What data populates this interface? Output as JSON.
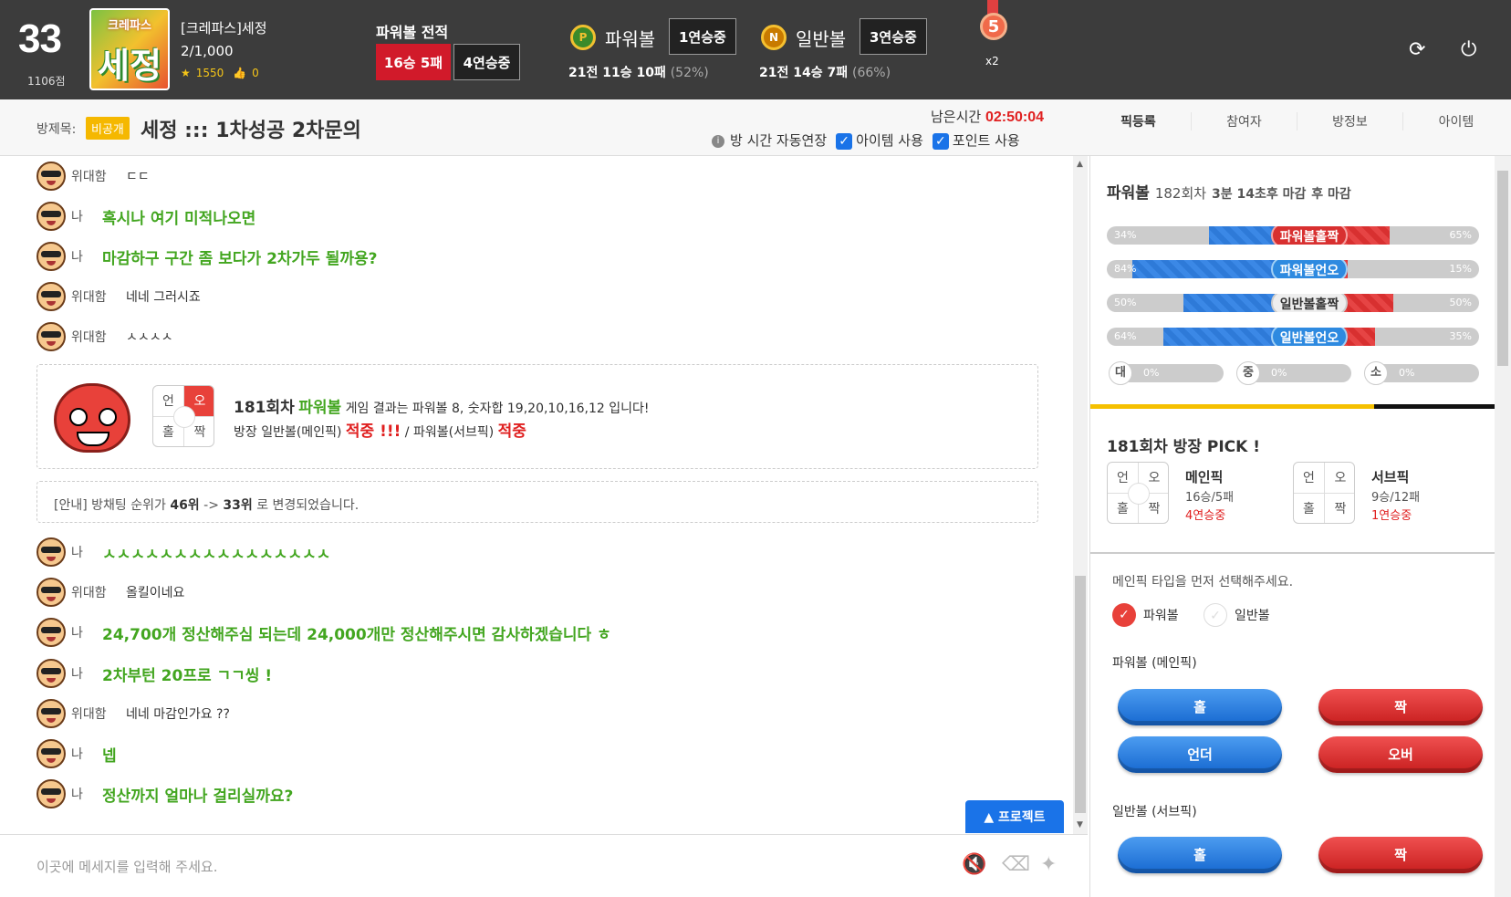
{
  "header": {
    "rank": "33",
    "rank_points": "1106점",
    "avatar_top": "크레파스",
    "avatar_main": "세정",
    "user_name": "[크레파스]세정",
    "user_count": "2/1,000",
    "stars": "1550",
    "likes": "0",
    "record_title": "파워볼 전적",
    "record_wl": "16승 5패",
    "record_streak": "4연승중",
    "powerball": {
      "coin": "P",
      "name": "파워볼",
      "streak": "1연승중",
      "record": "21전 11승 10패",
      "pct": "(52%)"
    },
    "normalball": {
      "coin": "N",
      "name": "일반볼",
      "streak": "3연승중",
      "record": "21전 14승 7패",
      "pct": "(66%)"
    },
    "medal_number": "5",
    "multiplier": "x2"
  },
  "room": {
    "label": "방제목:",
    "private": "비공개",
    "title": "세정 ::: 1차성공 2차문의",
    "remaining_label": "남은시간",
    "remaining_time": "02:50:04",
    "auto_extend": "방 시간 자동연장",
    "item_use": "아이템 사용",
    "point_use": "포인트 사용",
    "tabs": [
      "픽등록",
      "참여자",
      "방정보",
      "아이템"
    ]
  },
  "chat": {
    "messages": [
      {
        "who": "위대함",
        "text": "ㄷㄷ",
        "me": false
      },
      {
        "who": "나",
        "text": "혹시나 여기 미적나오면",
        "me": true
      },
      {
        "who": "나",
        "text": "마감하구 구간 좀 보다가 2차가두 될까용?",
        "me": true
      },
      {
        "who": "위대함",
        "text": "네네 그러시죠",
        "me": false
      },
      {
        "who": "위대함",
        "text": "ㅅㅅㅅㅅ",
        "me": false
      }
    ],
    "messages2": [
      {
        "who": "나",
        "text": "ㅅㅅㅅㅅㅅㅅㅅㅅㅅㅅㅅㅅㅅㅅㅅㅅ",
        "me": true
      },
      {
        "who": "위대함",
        "text": "올킬이네요",
        "me": false
      },
      {
        "who": "나",
        "text": "24,700개 정산해주심 되는데 24,000개만 정산해주시면 감사하겠습니다 ㅎ",
        "me": true
      },
      {
        "who": "나",
        "text": "2차부턴 20프로 ㄱㄱ씽 !",
        "me": true
      },
      {
        "who": "위대함",
        "text": "네네 마감인가요 ??",
        "me": false
      },
      {
        "who": "나",
        "text": "넵",
        "me": true
      },
      {
        "who": "나",
        "text": "정산까지 얼마나 걸리실까요?",
        "me": true
      }
    ],
    "result": {
      "grid": [
        "언",
        "오",
        "홀",
        "짝"
      ],
      "round": "181회차",
      "game": "파워볼",
      "line1": "게임 결과는 파워볼 8, 숫자합 19,20,10,16,12 입니다!",
      "line2a": "방장 일반볼(메인픽)",
      "hit1": "적중 !!!",
      "line2b": " / 파워볼(서브픽)",
      "hit2": "적중"
    },
    "notice_a": "[안내] 방채팅 순위가 ",
    "notice_from": "46위",
    "notice_b": " -> ",
    "notice_to": "33위",
    "notice_c": " 로 변경되었습니다.",
    "project_button": "▲ 프로젝트",
    "input_placeholder": "이곳에 메세지를 입력해 주세요."
  },
  "panel": {
    "game": "파워볼",
    "round": "182회차",
    "closing": "3분 14초후 마감",
    "closing_suffix": "후 마감",
    "bars": [
      {
        "label": "파워볼홀짝",
        "left": "34%",
        "right": "65%",
        "style": "red"
      },
      {
        "label": "파워볼언오",
        "left": "84%",
        "right": "15%",
        "style": "blue"
      },
      {
        "label": "일반볼홀짝",
        "left": "50%",
        "right": "50%",
        "style": "wht"
      },
      {
        "label": "일반볼언오",
        "left": "64%",
        "right": "35%",
        "style": "blue"
      }
    ],
    "mini": [
      {
        "icon": "대",
        "pct": "0%"
      },
      {
        "icon": "중",
        "pct": "0%"
      },
      {
        "icon": "소",
        "pct": "0%"
      }
    ],
    "pick_title": "181회차 방장 PICK !",
    "main_pick": {
      "name": "메인픽",
      "record": "16승/5패",
      "streak": "4연승중"
    },
    "sub_pick": {
      "name": "서브픽",
      "record": "9승/12패",
      "streak": "1연승중"
    },
    "grid": [
      "언",
      "오",
      "홀",
      "짝"
    ],
    "guide": "메인픽 타입을 먼저 선택해주세요.",
    "radio_power": "파워볼",
    "radio_normal": "일반볼",
    "sec_main": "파워볼 (메인픽)",
    "sec_sub": "일반볼 (서브픽)",
    "btn_odd": "홀",
    "btn_even": "짝",
    "btn_under": "언더",
    "btn_over": "오버"
  }
}
